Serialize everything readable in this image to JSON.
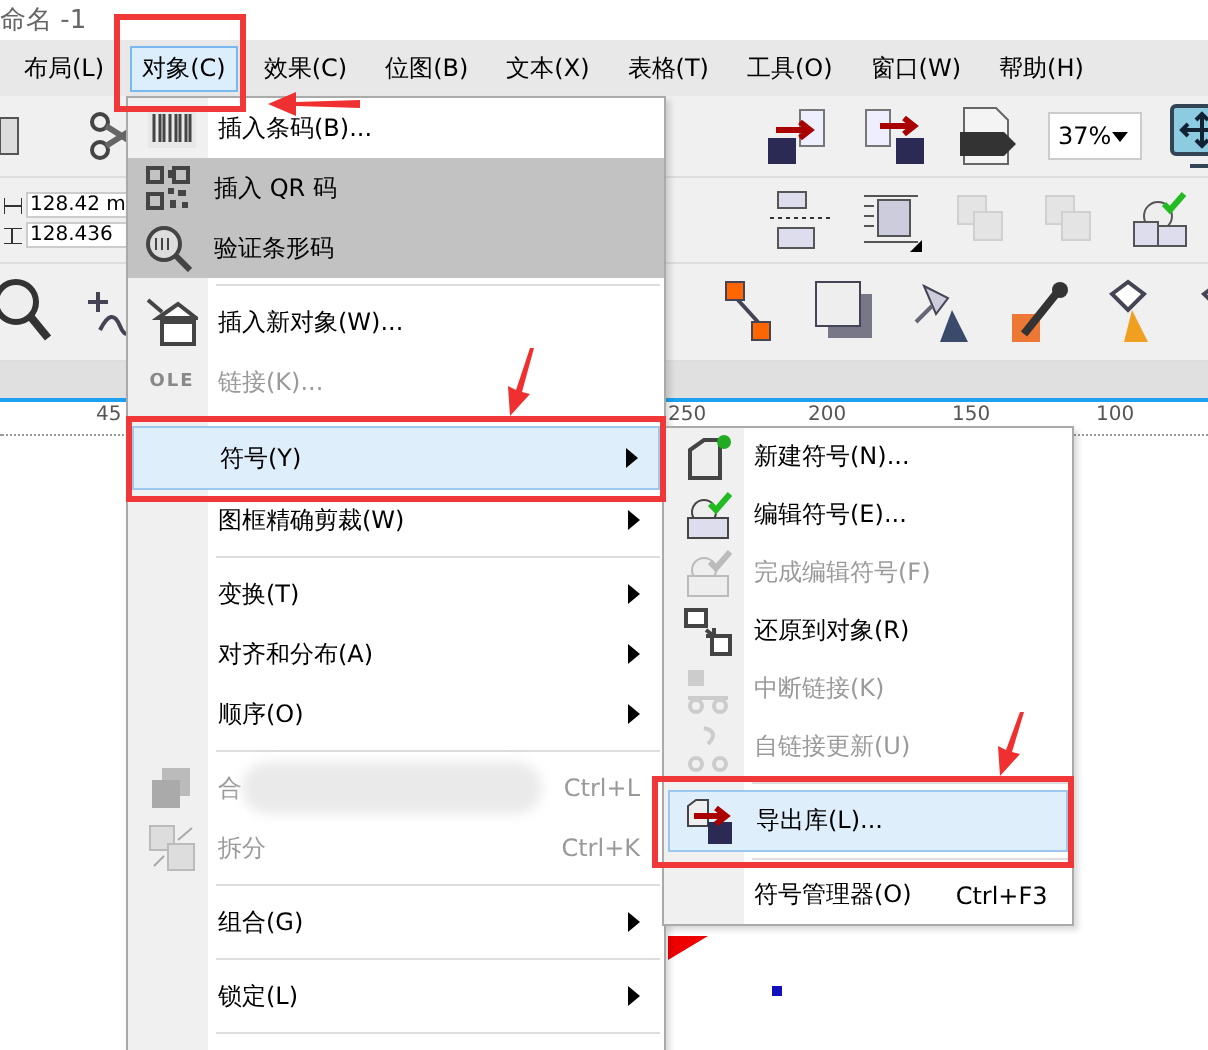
{
  "window": {
    "title": "命名 -1"
  },
  "menubar": [
    {
      "label": "布局(L)",
      "selected": false
    },
    {
      "label": "对象(C)",
      "selected": true
    },
    {
      "label": "效果(C)",
      "selected": false
    },
    {
      "label": "位图(B)",
      "selected": false
    },
    {
      "label": "文本(X)",
      "selected": false
    },
    {
      "label": "表格(T)",
      "selected": false
    },
    {
      "label": "工具(O)",
      "selected": false
    },
    {
      "label": "窗口(W)",
      "selected": false
    },
    {
      "label": "帮助(H)",
      "selected": false
    }
  ],
  "toolbar": {
    "width_value": "128.42 m",
    "height_value": "128.436",
    "zoom": "37%"
  },
  "ruler": [
    "45",
    "250",
    "200",
    "150",
    "100"
  ],
  "object_menu": [
    {
      "kind": "item",
      "label": "插入条码(B)...",
      "disabled": false,
      "selected": false,
      "highlighted": false,
      "submenu": false
    },
    {
      "kind": "item",
      "label": "插入 QR 码",
      "disabled": false,
      "selected": false,
      "highlighted": true,
      "submenu": false
    },
    {
      "kind": "item",
      "label": "验证条形码",
      "disabled": false,
      "selected": false,
      "highlighted": true,
      "submenu": false
    },
    {
      "kind": "separator"
    },
    {
      "kind": "item",
      "label": "插入新对象(W)...",
      "disabled": false,
      "selected": false,
      "highlighted": false,
      "submenu": false
    },
    {
      "kind": "item",
      "label": "链接(K)...",
      "disabled": true,
      "selected": false,
      "highlighted": false,
      "submenu": false,
      "icon_text": "OLE"
    },
    {
      "kind": "separator"
    },
    {
      "kind": "item",
      "label": "符号(Y)",
      "disabled": false,
      "selected": true,
      "highlighted": false,
      "submenu": true
    },
    {
      "kind": "item",
      "label": "图框精确剪裁(W)",
      "disabled": false,
      "selected": false,
      "highlighted": false,
      "submenu": true
    },
    {
      "kind": "separator"
    },
    {
      "kind": "item",
      "label": "变换(T)",
      "disabled": false,
      "selected": false,
      "highlighted": false,
      "submenu": true
    },
    {
      "kind": "item",
      "label": "对齐和分布(A)",
      "disabled": false,
      "selected": false,
      "highlighted": false,
      "submenu": true
    },
    {
      "kind": "item",
      "label": "顺序(O)",
      "disabled": false,
      "selected": false,
      "highlighted": false,
      "submenu": true
    },
    {
      "kind": "separator"
    },
    {
      "kind": "item",
      "label": "合",
      "shortcut": "Ctrl+L",
      "disabled": true,
      "selected": false,
      "highlighted": false,
      "submenu": false,
      "obscured": true
    },
    {
      "kind": "item",
      "label": "拆分",
      "shortcut": "Ctrl+K",
      "disabled": true,
      "selected": false,
      "highlighted": false,
      "submenu": false
    },
    {
      "kind": "separator"
    },
    {
      "kind": "item",
      "label": "组合(G)",
      "disabled": false,
      "selected": false,
      "highlighted": false,
      "submenu": true
    },
    {
      "kind": "separator"
    },
    {
      "kind": "item",
      "label": "锁定(L)",
      "disabled": false,
      "selected": false,
      "highlighted": false,
      "submenu": true
    },
    {
      "kind": "separator"
    }
  ],
  "symbol_submenu": [
    {
      "kind": "item",
      "label": "新建符号(N)...",
      "disabled": false,
      "selected": false
    },
    {
      "kind": "item",
      "label": "编辑符号(E)...",
      "disabled": false,
      "selected": false
    },
    {
      "kind": "item",
      "label": "完成编辑符号(F)",
      "disabled": true,
      "selected": false
    },
    {
      "kind": "item",
      "label": "还原到对象(R)",
      "disabled": false,
      "selected": false
    },
    {
      "kind": "item",
      "label": "中断链接(K)",
      "disabled": true,
      "selected": false
    },
    {
      "kind": "item",
      "label": "自链接更新(U)",
      "disabled": true,
      "selected": false
    },
    {
      "kind": "separator"
    },
    {
      "kind": "item",
      "label": "导出库(L)...",
      "disabled": false,
      "selected": true
    },
    {
      "kind": "separator"
    },
    {
      "kind": "item",
      "label": "符号管理器(O)",
      "shortcut": "Ctrl+F3",
      "disabled": false,
      "selected": false
    }
  ]
}
